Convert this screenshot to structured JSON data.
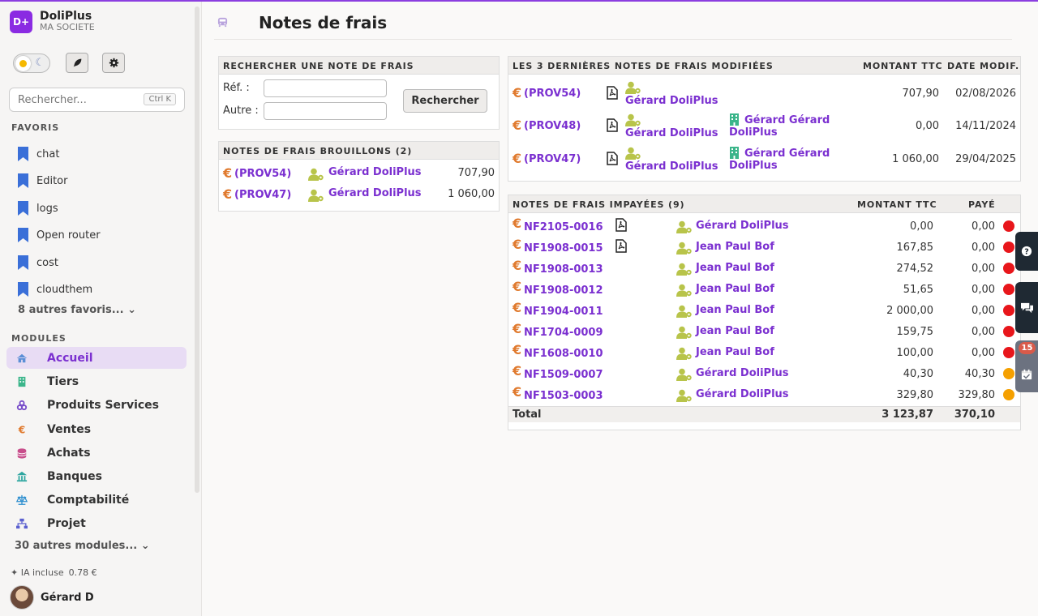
{
  "app": {
    "logo_text": "D+",
    "name": "DoliPlus",
    "company": "MA SOCIETE"
  },
  "search": {
    "placeholder": "Rechercher...",
    "shortcut": "Ctrl K"
  },
  "favorites": {
    "title": "FAVORIS",
    "items": [
      {
        "label": "chat"
      },
      {
        "label": "Editor"
      },
      {
        "label": "logs"
      },
      {
        "label": "Open router"
      },
      {
        "label": "cost"
      },
      {
        "label": "cloudthem"
      }
    ],
    "more_label": "8 autres favoris... ⌄"
  },
  "modules": {
    "title": "MODULES",
    "items": [
      {
        "label": "Accueil",
        "icon": "home-icon",
        "color": "#5b8fd6",
        "active": true
      },
      {
        "label": "Tiers",
        "icon": "building-icon",
        "color": "#3bb58a"
      },
      {
        "label": "Produits Services",
        "icon": "cubes-icon",
        "color": "#7a4fc9"
      },
      {
        "label": "Ventes",
        "icon": "euro-icon",
        "color": "#e07a2e"
      },
      {
        "label": "Achats",
        "icon": "coins-icon",
        "color": "#c84e8b"
      },
      {
        "label": "Banques",
        "icon": "bank-icon",
        "color": "#2ea6a0"
      },
      {
        "label": "Comptabilité",
        "icon": "scale-icon",
        "color": "#2e8fcf"
      },
      {
        "label": "Projet",
        "icon": "sitemap-icon",
        "color": "#5a5fcf"
      }
    ],
    "more_label": "30 autres modules... ⌄"
  },
  "footer": {
    "ia_label": "✦ IA incluse",
    "ia_amount": "0.78 €",
    "user_name": "Gérard D"
  },
  "page": {
    "title": "Notes de frais"
  },
  "search_panel": {
    "title": "RECHERCHER UNE NOTE DE FRAIS",
    "ref_label": "Réf. :",
    "other_label": "Autre :",
    "button": "Rechercher"
  },
  "drafts": {
    "title": "NOTES DE FRAIS BROUILLONS (2)",
    "rows": [
      {
        "ref": "(PROV54)",
        "user": "Gérard DoliPlus",
        "amount": "707,90"
      },
      {
        "ref": "(PROV47)",
        "user": "Gérard DoliPlus",
        "amount": "1 060,00"
      }
    ]
  },
  "latest": {
    "title": "LES 3 DERNIÈRES NOTES DE FRAIS MODIFIÉES",
    "col_amount": "MONTANT TTC",
    "col_date": "DATE MODIF.",
    "rows": [
      {
        "ref": "(PROV54)",
        "user": "Gérard DoliPlus",
        "thirdparty": "",
        "amount": "707,90",
        "date": "02/08/2026"
      },
      {
        "ref": "(PROV48)",
        "user": "Gérard DoliPlus",
        "thirdparty": "Gérard Gérard DoliPlus",
        "amount": "0,00",
        "date": "14/11/2024"
      },
      {
        "ref": "(PROV47)",
        "user": "Gérard DoliPlus",
        "thirdparty": "Gérard Gérard DoliPlus",
        "amount": "1 060,00",
        "date": "29/04/2025"
      }
    ]
  },
  "unpaid": {
    "title": "NOTES DE FRAIS IMPAYÉES (9)",
    "col_amount": "MONTANT TTC",
    "col_paid": "PAYÉ",
    "rows": [
      {
        "ref": "NF2105-0016",
        "pdf": true,
        "user": "Gérard DoliPlus",
        "amount": "0,00",
        "paid": "0,00",
        "status_color": "#e8161b"
      },
      {
        "ref": "NF1908-0015",
        "pdf": true,
        "user": "Jean Paul Bof",
        "amount": "167,85",
        "paid": "0,00",
        "status_color": "#e8161b"
      },
      {
        "ref": "NF1908-0013",
        "pdf": false,
        "user": "Jean Paul Bof",
        "amount": "274,52",
        "paid": "0,00",
        "status_color": "#e8161b"
      },
      {
        "ref": "NF1908-0012",
        "pdf": false,
        "user": "Jean Paul Bof",
        "amount": "51,65",
        "paid": "0,00",
        "status_color": "#e8161b"
      },
      {
        "ref": "NF1904-0011",
        "pdf": false,
        "user": "Jean Paul Bof",
        "amount": "2 000,00",
        "paid": "0,00",
        "status_color": "#e8161b"
      },
      {
        "ref": "NF1704-0009",
        "pdf": false,
        "user": "Jean Paul Bof",
        "amount": "159,75",
        "paid": "0,00",
        "status_color": "#e8161b"
      },
      {
        "ref": "NF1608-0010",
        "pdf": false,
        "user": "Jean Paul Bof",
        "amount": "100,00",
        "paid": "0,00",
        "status_color": "#e8161b"
      },
      {
        "ref": "NF1509-0007",
        "pdf": false,
        "user": "Gérard DoliPlus",
        "amount": "40,30",
        "paid": "40,30",
        "status_color": "#f5a000"
      },
      {
        "ref": "NF1503-0003",
        "pdf": false,
        "user": "Gérard DoliPlus",
        "amount": "329,80",
        "paid": "329,80",
        "status_color": "#f5a000"
      }
    ],
    "total_label": "Total",
    "total_amount": "3 123,87",
    "total_paid": "370,10"
  },
  "side_tabs": {
    "agenda_badge": "15"
  }
}
